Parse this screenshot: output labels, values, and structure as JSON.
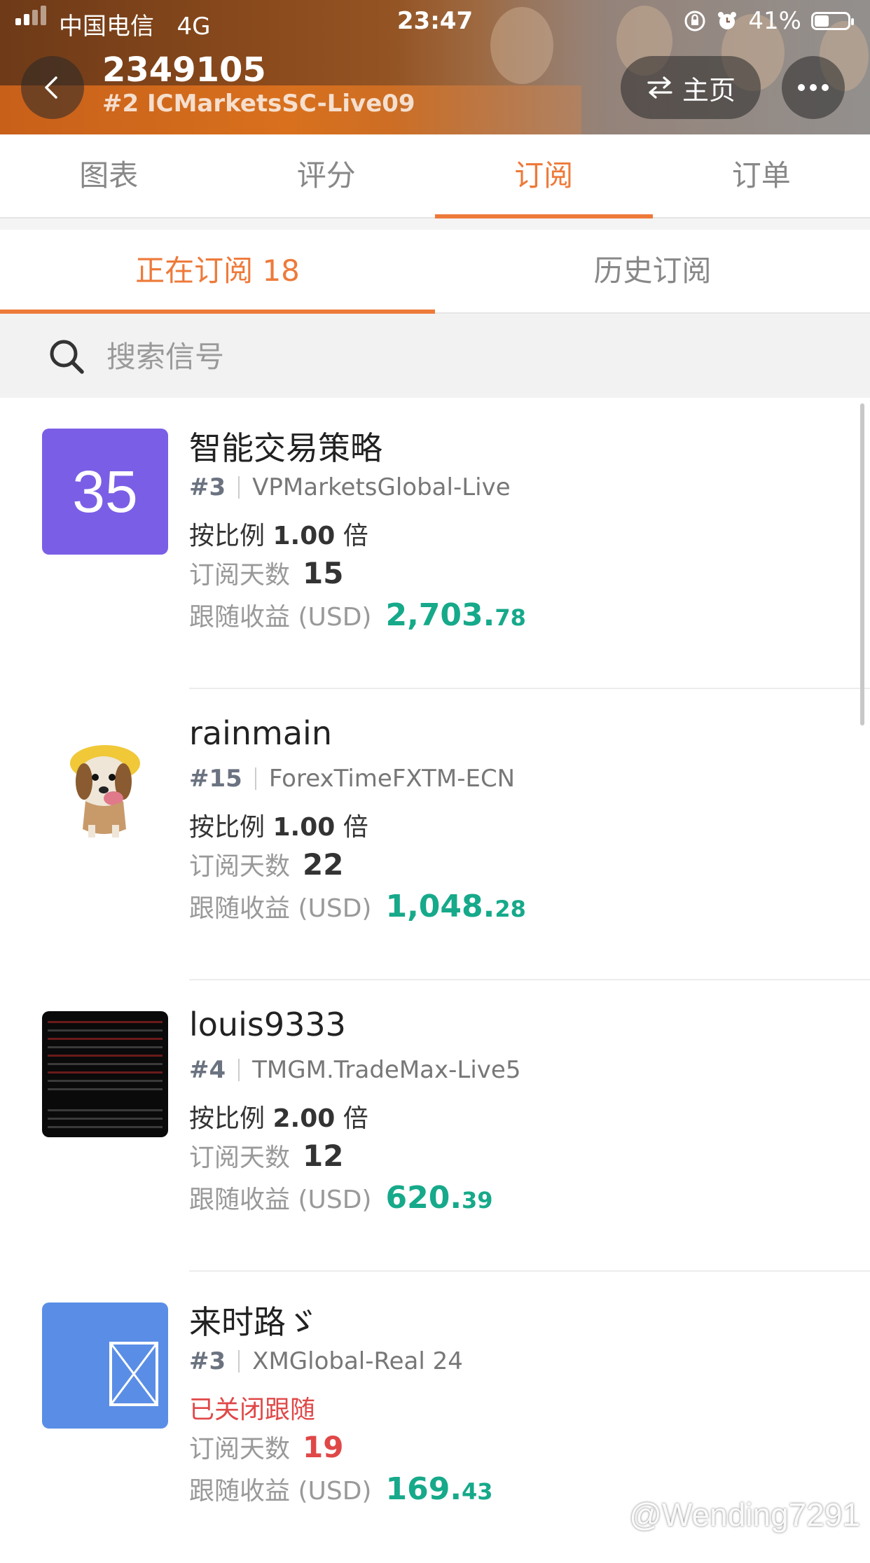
{
  "status_bar": {
    "carrier": "中国电信",
    "network": "4G",
    "time": "23:47",
    "battery": "41%"
  },
  "header": {
    "title": "2349105",
    "subtitle": "#2 ICMarketsSC-Live09",
    "home_label": "主页",
    "back_icon": "chevron-left-icon",
    "more_icon": "more-icon"
  },
  "main_tabs": [
    {
      "label": "图表",
      "active": false
    },
    {
      "label": "评分",
      "active": false
    },
    {
      "label": "订阅",
      "active": true
    },
    {
      "label": "订单",
      "active": false
    }
  ],
  "sub_tabs": [
    {
      "label": "正在订阅 18",
      "active": true
    },
    {
      "label": "历史订阅",
      "active": false
    }
  ],
  "search": {
    "placeholder": "搜索信号"
  },
  "labels": {
    "ratio_prefix": "按比例",
    "ratio_suffix": "倍",
    "days": "订阅天数",
    "profit": "跟随收益 (USD)"
  },
  "items": [
    {
      "avatar_text": "35",
      "name": "智能交易策略",
      "rank": "#3",
      "broker": "VPMarketsGlobal-Live",
      "ratio": "1.00",
      "days": "15",
      "profit_int": "2,703.",
      "profit_dec": "78"
    },
    {
      "name": "rainmain",
      "rank": "#15",
      "broker": "ForexTimeFXTM-ECN",
      "ratio": "1.00",
      "days": "22",
      "profit_int": "1,048.",
      "profit_dec": "28"
    },
    {
      "name": "louis9333",
      "rank": "#4",
      "broker": "TMGM.TradeMax-Live5",
      "ratio": "2.00",
      "days": "12",
      "profit_int": "620.",
      "profit_dec": "39"
    },
    {
      "name": "来时路ゞ",
      "rank": "#3",
      "broker": "XMGlobal-Real 24",
      "status": "已关闭跟随",
      "days": "19",
      "profit_int": "169.",
      "profit_dec": "43"
    }
  ],
  "watermark": "@Wending7291",
  "colors": {
    "accent": "#ee7a3a",
    "profit": "#16a98a",
    "closed": "#e04848"
  }
}
